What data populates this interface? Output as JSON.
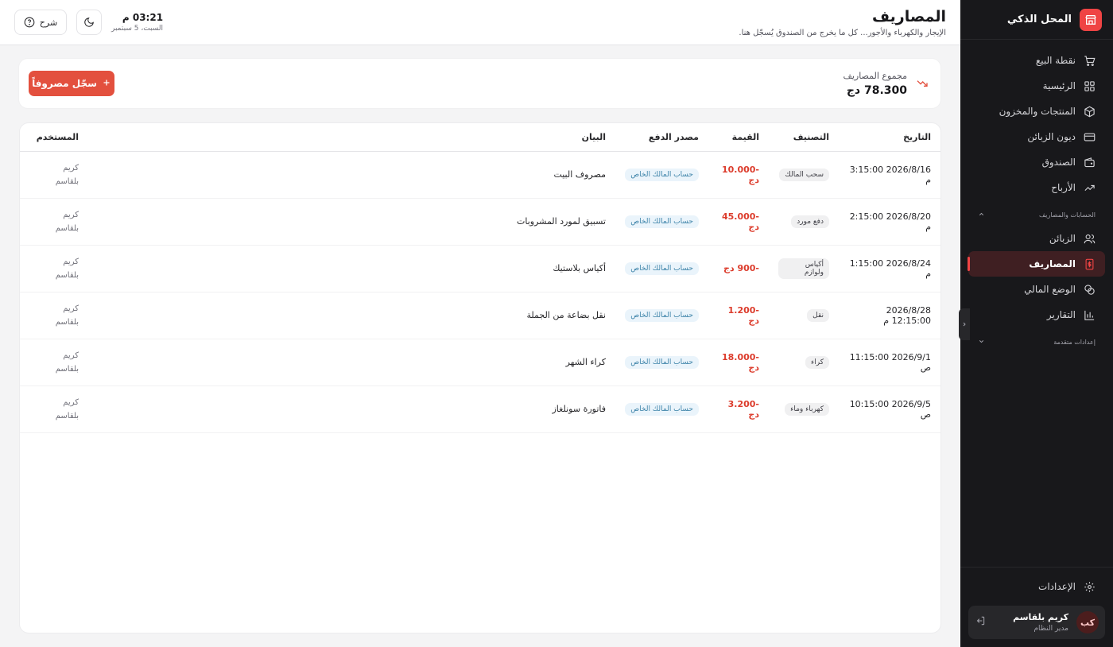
{
  "sidebar": {
    "brand": "المحل الذكي",
    "items": [
      {
        "label": "نقطة البيع",
        "icon": "cart-icon"
      },
      {
        "label": "الرئيسية",
        "icon": "grid-icon"
      },
      {
        "label": "المنتجات والمخزون",
        "icon": "box-icon"
      },
      {
        "label": "ديون الزبائن",
        "icon": "card-icon"
      },
      {
        "label": "الصندوق",
        "icon": "wallet-icon"
      },
      {
        "label": "الأرباح",
        "icon": "trend-up-icon"
      }
    ],
    "group_accounts": "الحسابات والمصاريف",
    "group_items": [
      {
        "label": "الزبائن",
        "icon": "users-icon"
      },
      {
        "label": "المصاريف",
        "icon": "receipt-icon",
        "active": true
      },
      {
        "label": "الوضع المالي",
        "icon": "coins-icon"
      },
      {
        "label": "التقارير",
        "icon": "bar-chart-icon"
      }
    ],
    "group_advanced": "إعدادات متقدمة",
    "settings": "الإعدادات",
    "user": {
      "initials": "كب",
      "name": "كريم بلقاسم",
      "role": "مدير النظام"
    }
  },
  "header": {
    "title": "المصاريف",
    "subtitle": "الإيجار والكهرباء والأجور... كل ما يخرج من الصندوق يُسجّل هنا.",
    "time": "03:21 م",
    "date": "السبت، 5 سبتمبر",
    "help_label": "شرح"
  },
  "summary": {
    "label": "مجموع المصاريف",
    "value": "78.300 دج",
    "add_label": "سجّل مصروفاً"
  },
  "table": {
    "headers": {
      "date": "التاريخ",
      "category": "التصنيف",
      "value": "القيمة",
      "source": "مصدر الدفع",
      "statement": "البيان",
      "user": "المستخدم"
    },
    "rows": [
      {
        "date": "2026/8/16 3:15:00 م",
        "category": "سحب المالك",
        "value": "-10.000 دج",
        "source": "حساب المالك الخاص",
        "statement": "مصروف البيت",
        "user1": "كريم",
        "user2": "بلقاسم"
      },
      {
        "date": "2026/8/20 2:15:00 م",
        "category": "دفع مورد",
        "value": "-45.000 دج",
        "source": "حساب المالك الخاص",
        "statement": "تسبيق لمورد المشروبات",
        "user1": "كريم",
        "user2": "بلقاسم"
      },
      {
        "date": "2026/8/24 1:15:00 م",
        "category": "أكياس ولوازم",
        "value": "-900 دج",
        "source": "حساب المالك الخاص",
        "statement": "أكياس بلاستيك",
        "user1": "كريم",
        "user2": "بلقاسم"
      },
      {
        "date": "2026/8/28 12:15:00 م",
        "category": "نقل",
        "value": "-1.200 دج",
        "source": "حساب المالك الخاص",
        "statement": "نقل بضاعة من الجملة",
        "user1": "كريم",
        "user2": "بلقاسم"
      },
      {
        "date": "2026/9/1 11:15:00 ص",
        "category": "كراء",
        "value": "-18.000 دج",
        "source": "حساب المالك الخاص",
        "statement": "كراء الشهر",
        "user1": "كريم",
        "user2": "بلقاسم"
      },
      {
        "date": "2026/9/5 10:15:00 ص",
        "category": "كهرباء وماء",
        "value": "-3.200 دج",
        "source": "حساب المالك الخاص",
        "statement": "فاتورة سونلغاز",
        "user1": "كريم",
        "user2": "بلقاسم"
      }
    ]
  },
  "colors": {
    "accent": "#e3503e",
    "sidebar_bg": "#18181b",
    "negative": "#dc3c2c"
  }
}
